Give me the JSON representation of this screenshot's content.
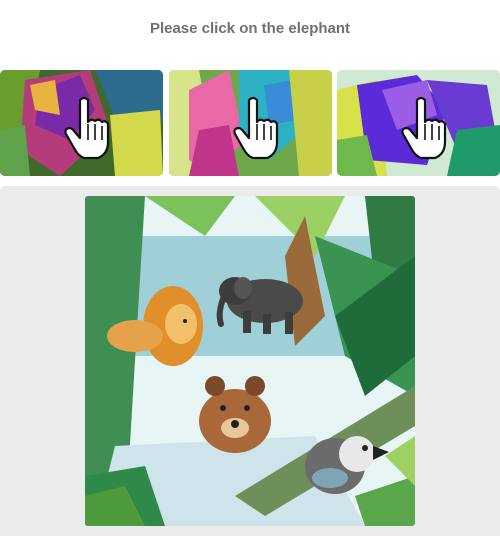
{
  "prompt": {
    "text": "Please click on the elephant"
  },
  "thumbnails": [
    {
      "animal_icon": "elephant-icon",
      "palette": [
        "#c1467a",
        "#7a2aa6",
        "#e9b341",
        "#3f8a3a"
      ]
    },
    {
      "animal_icon": "parrot-icon",
      "palette": [
        "#e869a6",
        "#2cb2c4",
        "#3a8bd8",
        "#c8d04a"
      ]
    },
    {
      "animal_icon": "elephant-icon",
      "palette": [
        "#5a2bd6",
        "#9b5de5",
        "#d8e04a",
        "#1f9b6b"
      ]
    }
  ],
  "scene": {
    "animals": [
      "elephant-icon",
      "lion-icon",
      "bear-icon",
      "parrot-icon"
    ],
    "colors": {
      "water": "#cfe3ea",
      "foliage": "#2f8a4a",
      "sky": "#e8f5f5"
    }
  }
}
